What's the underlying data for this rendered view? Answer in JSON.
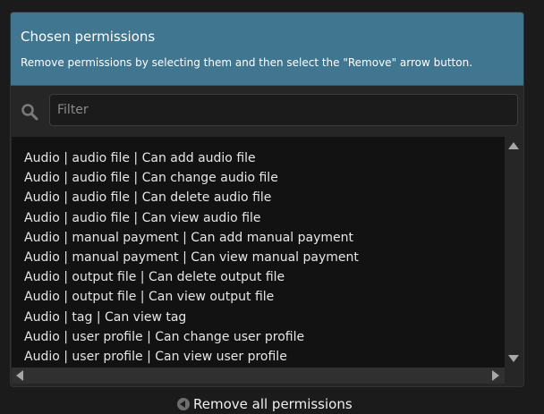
{
  "header": {
    "title": "Chosen permissions",
    "help_text": "Remove permissions by selecting them and then select the \"Remove\" arrow button."
  },
  "filter": {
    "placeholder": "Filter",
    "value": ""
  },
  "options": [
    "Audio | audio file | Can add audio file",
    "Audio | audio file | Can change audio file",
    "Audio | audio file | Can delete audio file",
    "Audio | audio file | Can view audio file",
    "Audio | manual payment | Can add manual payment",
    "Audio | manual payment | Can view manual payment",
    "Audio | output file | Can delete output file",
    "Audio | output file | Can view output file",
    "Audio | tag | Can view tag",
    "Audio | user profile | Can change user profile",
    "Audio | user profile | Can view user profile"
  ],
  "footer": {
    "remove_all_label": "Remove all permissions"
  },
  "colors": {
    "header_bg": "#417690",
    "page_bg": "#1b1b1b",
    "list_bg": "#121212",
    "text": "#e6e6e6"
  },
  "icons": {
    "search": "search-icon",
    "scroll_up": "arrow-up-icon",
    "scroll_down": "arrow-down-icon",
    "scroll_left": "arrow-left-icon",
    "scroll_right": "arrow-right-icon",
    "remove_all": "chevron-left-circle-icon"
  }
}
